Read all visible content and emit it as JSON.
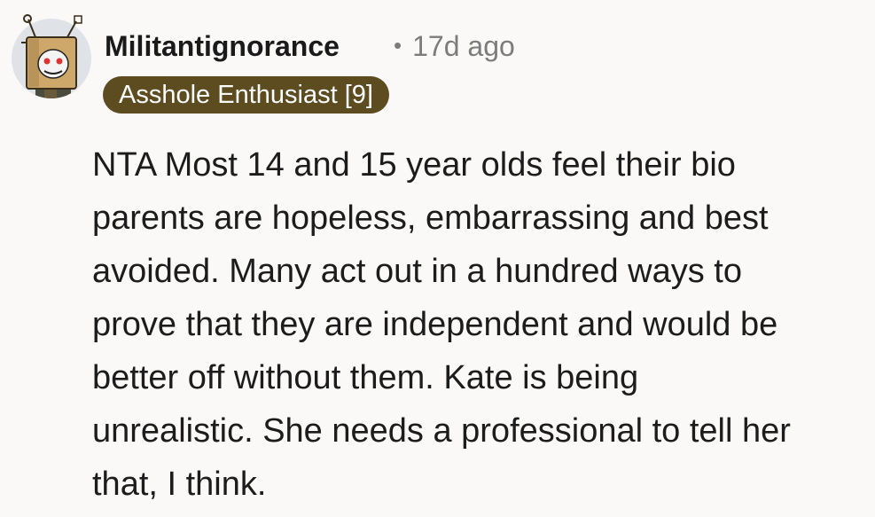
{
  "comment": {
    "username": "Militantignorance",
    "separator": "•",
    "timestamp": "17d ago",
    "flair": "Asshole Enthusiast [9]",
    "avatar_icon": "robot-tv-avatar-icon",
    "body_lines": [
      "NTA Most 14 and 15 year olds feel their bio",
      "parents are hopeless, embarrassing and best",
      "avoided. Many act out in a hundred ways to",
      "prove that they are independent and would be",
      "better off without them. Kate is being",
      "unrealistic. She needs a professional to tell her",
      "that, I think."
    ]
  },
  "colors": {
    "background": "#faf9f8",
    "flair_background": "#5e4c21",
    "flair_text": "#ffffff",
    "meta_text": "#7c7c7c",
    "body_text": "#1c1c1c"
  }
}
